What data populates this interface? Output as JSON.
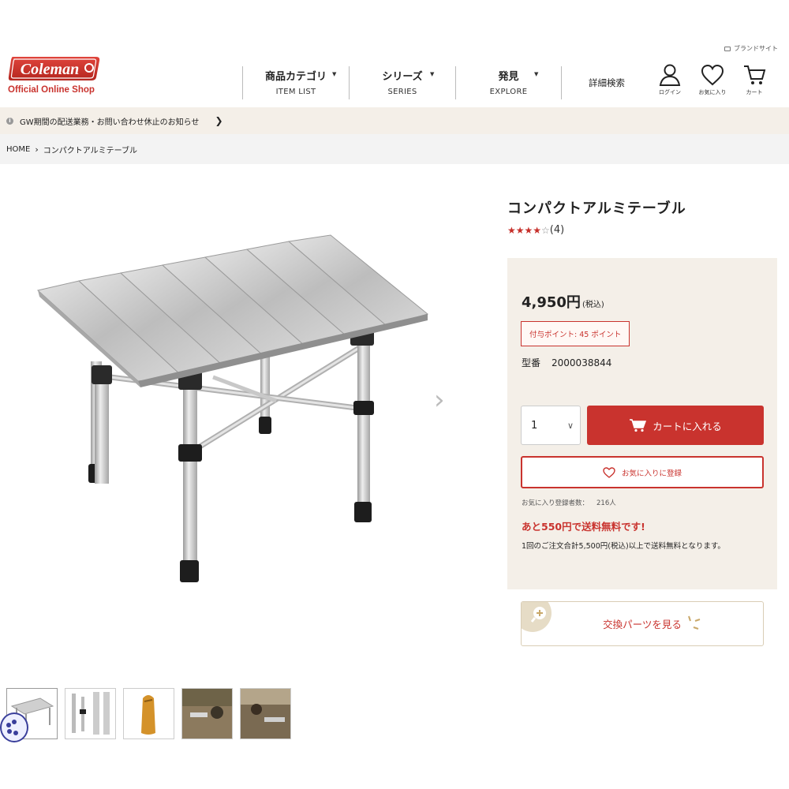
{
  "header": {
    "brand_site_label": "ブランドサイト",
    "logo_text": "Coleman",
    "logo_sub": "Official Online Shop",
    "nav": [
      {
        "jp": "商品カテゴリ",
        "en": "ITEM LIST"
      },
      {
        "jp": "シリーズ",
        "en": "SERIES"
      },
      {
        "jp": "発見",
        "en": "EXPLORE"
      }
    ],
    "detail_search": "詳細検索",
    "icons": [
      {
        "name": "user-icon",
        "label": "ログイン"
      },
      {
        "name": "heart-icon",
        "label": "お気に入り"
      },
      {
        "name": "cart-icon",
        "label": "カート"
      }
    ]
  },
  "notice": {
    "icon": "info-icon",
    "text": "GW期間の配送業務・お問い合わせ休止のお知らせ"
  },
  "breadcrumb": {
    "home": "HOME",
    "current": "コンパクトアルミテーブル"
  },
  "product": {
    "title": "コンパクトアルミテーブル",
    "rating": 4,
    "rating_max": 5,
    "review_count": "(4)",
    "price": "4,950円",
    "tax_label": "(税込)",
    "points": "付与ポイント: 45 ポイント",
    "model_label": "型番",
    "model_number": "2000038844",
    "quantity": "1",
    "add_to_cart": "カートに入れる",
    "add_to_favorites": "お気に入りに登録",
    "fav_count_label": "お気に入り登録者数：",
    "fav_count": "216人",
    "free_shipping": "あと550円で送料無料です!",
    "shipping_note": "1回のご注文合計5,500円(税込)以上で送料無料となります。",
    "parts_button": "交換パーツを見る"
  },
  "gallery": {
    "thumbnails": [
      {
        "name": "thumb-table",
        "active": true
      },
      {
        "name": "thumb-folded"
      },
      {
        "name": "thumb-carry-bag"
      },
      {
        "name": "thumb-scene-1"
      },
      {
        "name": "thumb-scene-2"
      }
    ]
  },
  "colors": {
    "brand_red": "#c9332e",
    "beige": "#f4efe8"
  }
}
